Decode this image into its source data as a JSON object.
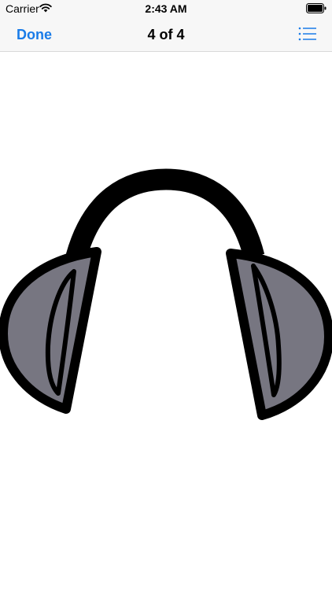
{
  "status_bar": {
    "carrier": "Carrier",
    "time": "2:43 AM",
    "icons": [
      "wifi-icon",
      "battery-icon"
    ]
  },
  "nav": {
    "done_label": "Done",
    "title": "4 of 4",
    "list_icon": "list-icon"
  },
  "sticker": {
    "name": "headphones",
    "colors": {
      "outline": "#000000",
      "cushion": "#777681",
      "background": "#ffffff"
    }
  },
  "colors": {
    "accent": "#1a7ce8",
    "bar_background": "#f7f7f7"
  }
}
